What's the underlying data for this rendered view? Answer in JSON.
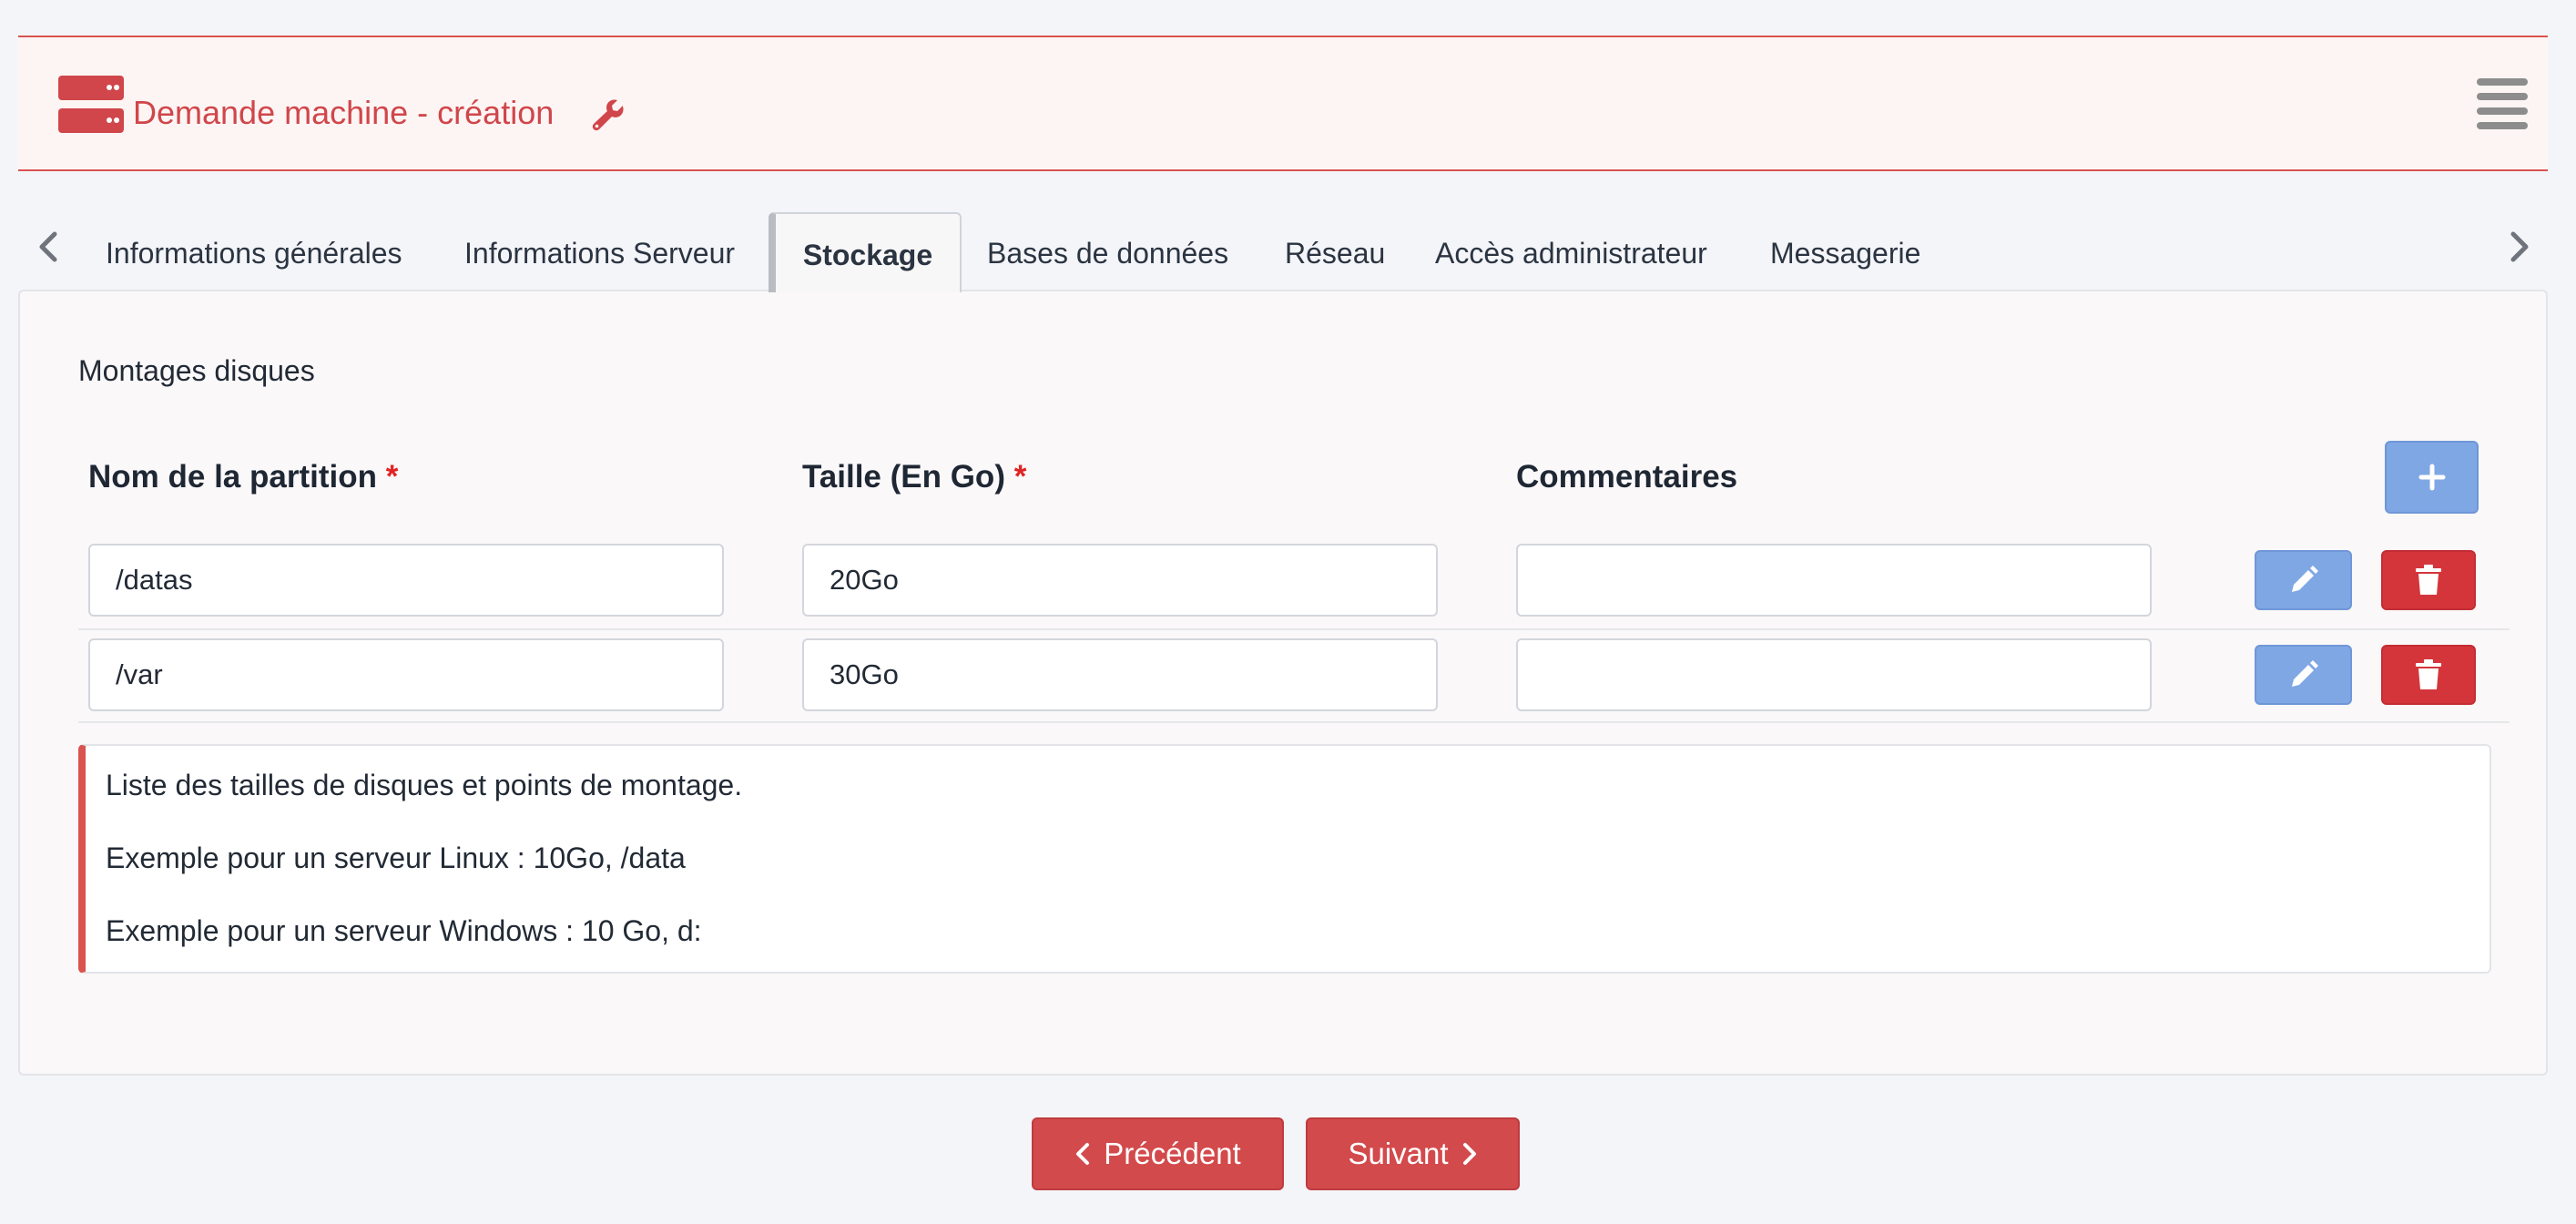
{
  "header": {
    "title": "Demande machine - création",
    "icons": {
      "logo": "server-icon",
      "tool": "wrench-icon",
      "menu": "hamburger-menu-icon"
    },
    "accent_color": "#d9534f"
  },
  "tabs": {
    "items": [
      {
        "label": "Informations générales",
        "active": false
      },
      {
        "label": "Informations Serveur",
        "active": false
      },
      {
        "label": "Stockage",
        "active": true
      },
      {
        "label": "Bases de données",
        "active": false
      },
      {
        "label": "Réseau",
        "active": false
      },
      {
        "label": "Accès administrateur",
        "active": false
      },
      {
        "label": "Messagerie",
        "active": false
      }
    ],
    "icons": {
      "prev": "chevron-left-icon",
      "next": "chevron-right-icon"
    }
  },
  "storage": {
    "section_title": "Montages disques",
    "columns": {
      "partition": "Nom de la partition",
      "size": "Taille (En Go)",
      "comments": "Commentaires",
      "required_mark": "*"
    },
    "rows": [
      {
        "partition": "/datas",
        "size": "20Go",
        "comments": ""
      },
      {
        "partition": "/var",
        "size": "30Go",
        "comments": ""
      }
    ],
    "icons": {
      "add": "plus-icon",
      "edit": "pencil-icon",
      "delete": "trash-icon"
    },
    "note": [
      "Liste des tailles de disques et points de montage.",
      "Exemple pour un serveur Linux : 10Go, /data",
      "Exemple pour un serveur Windows : 10 Go, d:"
    ]
  },
  "footer": {
    "prev_label": "Précédent",
    "next_label": "Suivant",
    "button_color": "#d34a4c"
  }
}
